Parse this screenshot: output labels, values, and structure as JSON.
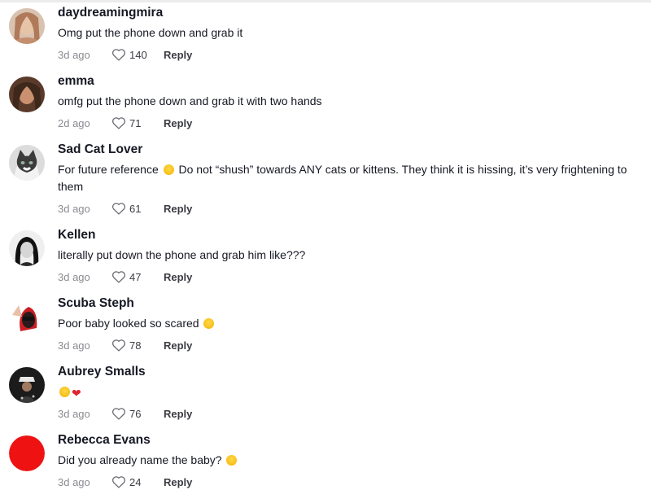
{
  "comments": [
    {
      "username": "daydreamingmira",
      "text": "Omg put the phone down and grab it",
      "time": "3d ago",
      "likes": "140",
      "reply_label": "Reply",
      "avatar_color": "#c9a488"
    },
    {
      "username": "emma",
      "text": "omfg put the phone down and grab it with two hands",
      "time": "2d ago",
      "likes": "71",
      "reply_label": "Reply",
      "avatar_color": "#6e4a36"
    },
    {
      "username": "Sad Cat Lover",
      "text_before_emoji": "For future reference ",
      "text_after_emoji": " Do not “shush” towards ANY cats or kittens. They think it is hissing, it’s very frightening to them",
      "emoji": "sweat-smile-emoji",
      "time": "3d ago",
      "likes": "61",
      "reply_label": "Reply",
      "avatar_color": "#9a9a9a"
    },
    {
      "username": "Kellen",
      "text": "literally put down the phone and grab him like???",
      "time": "3d ago",
      "likes": "47",
      "reply_label": "Reply",
      "avatar_color": "#d8d8d8"
    },
    {
      "username": "Scuba Steph",
      "text_before_emoji": "Poor baby looked so scared ",
      "emoji": "pleading-face-emoji",
      "time": "3d ago",
      "likes": "78",
      "reply_label": "Reply",
      "avatar_color": "#d2262b"
    },
    {
      "username": "Aubrey Smalls",
      "emojis": [
        "crying-face-emoji",
        "mending-heart-emoji"
      ],
      "time": "3d ago",
      "likes": "76",
      "reply_label": "Reply",
      "avatar_color": "#1c1c1c"
    },
    {
      "username": "Rebecca Evans",
      "text_before_emoji": "Did you already name the baby? ",
      "emoji": "pleading-face-emoji",
      "time": "3d ago",
      "likes": "24",
      "reply_label": "Reply",
      "avatar_color": "#ee1212"
    }
  ],
  "icons": {
    "like": "heart-outline-icon"
  }
}
